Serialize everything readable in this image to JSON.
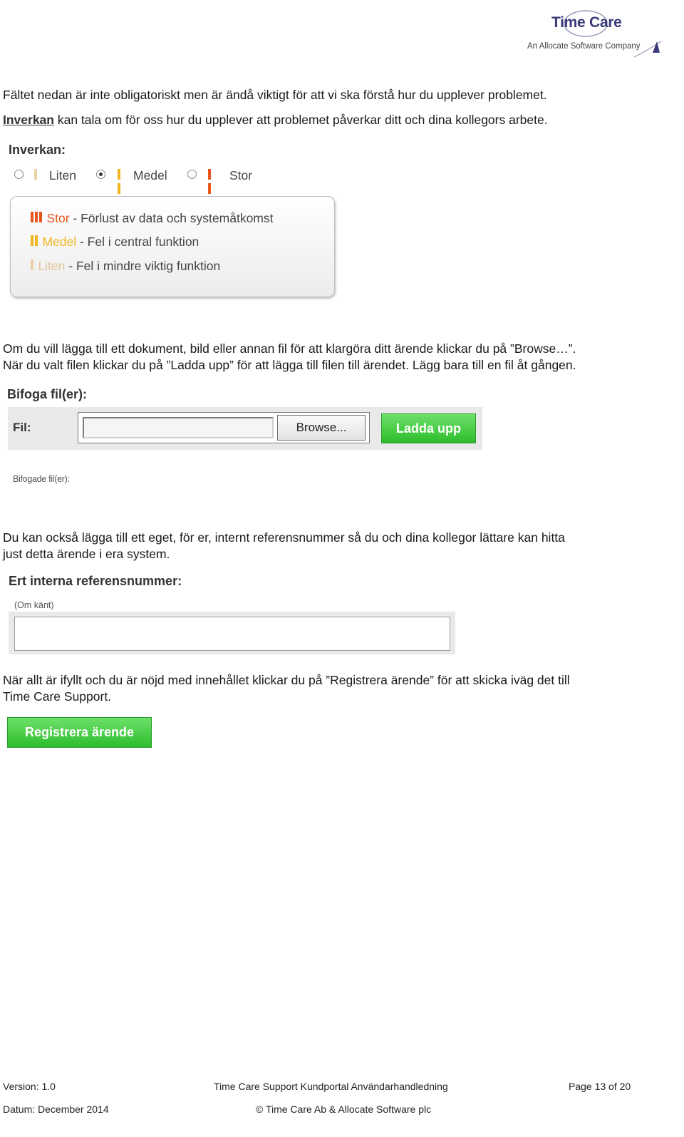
{
  "logo": {
    "brand_left": "Time",
    "brand_right": "Care",
    "tagline": "An Allocate Software Company"
  },
  "intro": {
    "line1": "Fältet nedan är inte obligatoriskt men är ändå viktigt för att vi ska förstå hur du upplever problemet.",
    "link": "Inverkan",
    "line2_rest": " kan tala om för oss hur du upplever att problemet påverkar ditt och dina kollegors arbete."
  },
  "impact": {
    "title": "Inverkan:",
    "options": [
      {
        "label": "Liten",
        "selected": false,
        "bars": 1
      },
      {
        "label": "Medel",
        "selected": true,
        "bars": 2
      },
      {
        "label": "Stor",
        "selected": false,
        "bars": 3
      }
    ],
    "legend": [
      {
        "level": "Stor",
        "desc": " - Förlust av data och systemåtkomst",
        "color": "#e8561c",
        "bars": 3
      },
      {
        "level": "Medel",
        "desc": " - Fel i central funktion",
        "color": "#f0b51e",
        "bars": 2
      },
      {
        "level": "Liten",
        "desc": " - Fel i mindre viktig funktion",
        "color": "#ead0a6",
        "bars": 1
      }
    ]
  },
  "attach_text": {
    "line1": "Om du vill lägga till ett dokument, bild eller annan fil för att klargöra ditt ärende klickar du på ”Browse…”.",
    "line2": "När du valt filen klickar du på ”Ladda upp” för att lägga till filen till ärendet. Lägg bara till en fil åt gången."
  },
  "attach": {
    "title": "Bifoga fil(er):",
    "file_label": "Fil:",
    "browse": "Browse...",
    "upload": "Ladda upp",
    "attached_label": "Bifogade fil(er):"
  },
  "ref_text": {
    "line1": "Du kan också lägga till ett eget, för er, internt referensnummer så du och dina kollegor lättare kan hitta",
    "line2": "just detta ärende i era system."
  },
  "ref": {
    "title": "Ert interna referensnummer:",
    "hint": "(Om känt)"
  },
  "submit_text": {
    "line1": "När allt är ifyllt och du är nöjd med innehållet klickar du på ”Registrera ärende” för att skicka iväg det till",
    "line2": "Time Care Support."
  },
  "submit": {
    "label": "Registrera ärende"
  },
  "footer": {
    "version": "Version:  1.0",
    "date": "Datum:  December 2014",
    "doc_title": "Time Care Support Kundportal Användarhandledning",
    "copyright": "© Time Care Ab & Allocate Software plc",
    "page": "Page 13 of 20"
  },
  "colors": {
    "accent_orange": "#e8561c",
    "accent_yellow": "#f0b51e",
    "accent_beige": "#ead0a6",
    "button_green": "#3ec93b",
    "logo_navy": "#3a3a7a"
  }
}
